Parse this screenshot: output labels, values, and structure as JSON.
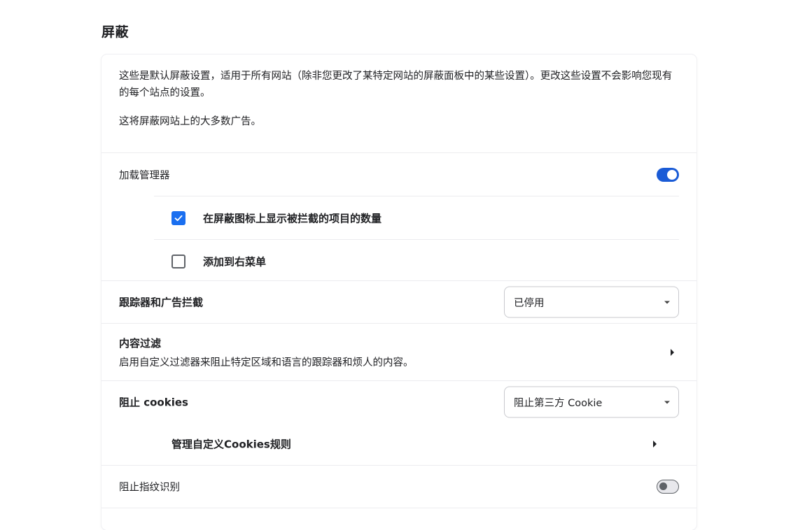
{
  "page": {
    "title": "屏蔽"
  },
  "intro": {
    "line1": "这些是默认屏蔽设置，适用于所有网站（除非您更改了某特定网站的屏蔽面板中的某些设置）。更改这些设置不会影响您现有的每个站点的设置。",
    "line2": "这将屏蔽网站上的大多数广告。"
  },
  "download_manager": {
    "label": "加载管理器",
    "enabled": true,
    "options": [
      {
        "label": "在屏蔽图标上显示被拦截的项目的数量",
        "checked": true
      },
      {
        "label": "添加到右菜单",
        "checked": false
      }
    ]
  },
  "trackers": {
    "label": "跟踪器和广告拦截",
    "selected": "已停用"
  },
  "content_filter": {
    "title": "内容过滤",
    "description": "启用自定义过滤器来阻止特定区域和语言的跟踪器和烦人的内容。"
  },
  "cookies": {
    "label": "阻止 cookies",
    "selected": "阻止第三方 Cookie",
    "manage_label": "管理自定义Cookies规则"
  },
  "fingerprint": {
    "label": "阻止指纹识别",
    "enabled": false
  },
  "colors": {
    "accent": "#1a5bd6",
    "checkbox": "#1a6ff0",
    "divider": "#ececef"
  }
}
